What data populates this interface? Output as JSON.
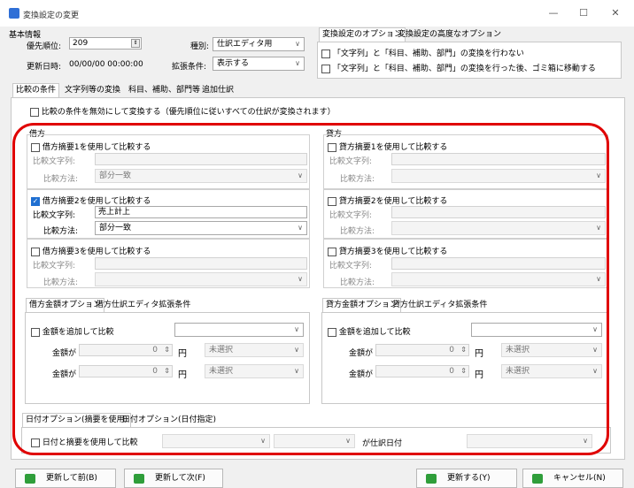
{
  "window": {
    "title": "変換設定の変更",
    "minimize": "—",
    "maximize": "☐",
    "close": "✕"
  },
  "basic": {
    "heading": "基本情報",
    "priority_label": "優先順位:",
    "priority_value": "209",
    "type_label": "種別:",
    "type_value": "仕訳エディタ用",
    "updated_label": "更新日時:",
    "updated_value": "00/00/00 00:00:00",
    "extension_label": "拡張条件:",
    "extension_value": "表示する"
  },
  "options_tabs": [
    "変換設定のオプション",
    "変換設定の高度なオプション"
  ],
  "options": [
    "「文字列」と「科目、補助、部門」の変換を行わない",
    "「文字列」と「科目、補助、部門」の変換を行った後、ゴミ箱に移動する"
  ],
  "main_tabs": [
    "比較の条件",
    "文字列等の変換",
    "科目、補助、部門等",
    "追加仕訳"
  ],
  "disable_compare": "比較の条件を無効にして変換する（優先順位に従いすべての仕訳が変換されます）",
  "debit": {
    "heading": "借方",
    "items": [
      {
        "label": "借方摘要1を使用して比較する",
        "checked": false,
        "str_label": "比較文字列:",
        "str_value": "",
        "method_label": "比較方法:",
        "method_value": "部分一致"
      },
      {
        "label": "借方摘要2を使用して比較する",
        "checked": true,
        "str_label": "比較文字列:",
        "str_value": "売上計上",
        "method_label": "比較方法:",
        "method_value": "部分一致"
      },
      {
        "label": "借方摘要3を使用して比較する",
        "checked": false,
        "str_label": "比較文字列:",
        "str_value": "",
        "method_label": "比較方法:",
        "method_value": ""
      }
    ]
  },
  "credit": {
    "heading": "貸方",
    "items": [
      {
        "label": "貸方摘要1を使用して比較する",
        "checked": false,
        "str_label": "比較文字列:",
        "str_value": "",
        "method_label": "比較方法:",
        "method_value": ""
      },
      {
        "label": "貸方摘要2を使用して比較する",
        "checked": false,
        "str_label": "比較文字列:",
        "str_value": "",
        "method_label": "比較方法:",
        "method_value": ""
      },
      {
        "label": "貸方摘要3を使用して比較する",
        "checked": false,
        "str_label": "比較文字列:",
        "str_value": "",
        "method_label": "比較方法:",
        "method_value": ""
      }
    ]
  },
  "debit_amount": {
    "tabs": [
      "借方金額オプション",
      "借方仕訳エディタ拡張条件"
    ],
    "add_label": "金額を追加して比較",
    "row1_label": "金額が",
    "row1_value": "0",
    "row1_unit": "円",
    "row1_select": "未選択",
    "row2_label": "金額が",
    "row2_value": "0",
    "row2_unit": "円",
    "row2_select": "未選択"
  },
  "credit_amount": {
    "tabs": [
      "貸方金額オプション",
      "貸方仕訳エディタ拡張条件"
    ],
    "add_label": "金額を追加して比較",
    "row1_label": "金額が",
    "row1_value": "0",
    "row1_unit": "円",
    "row1_select": "未選択",
    "row2_label": "金額が",
    "row2_value": "0",
    "row2_unit": "円",
    "row2_select": "未選択"
  },
  "date": {
    "tabs": [
      "日付オプション(摘要を使用)",
      "日付オプション(日付指定)"
    ],
    "use_label": "日付と摘要を使用して比較",
    "suffix": "が仕訳日付"
  },
  "buttons": {
    "prev": "更新して前(B)",
    "next": "更新して次(F)",
    "update": "更新する(Y)",
    "cancel": "キャンセル(N)"
  },
  "colors": {
    "highlight_ring": "#e00000",
    "check_accent": "#1f6fd1"
  }
}
